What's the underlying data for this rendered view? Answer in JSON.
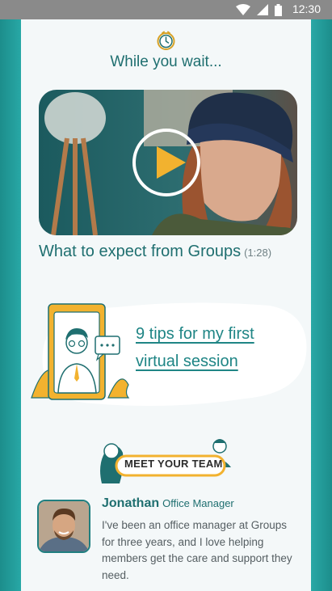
{
  "status_bar": {
    "time": "12:30",
    "icons": [
      "wifi-icon",
      "signal-icon",
      "battery-icon"
    ]
  },
  "header": {
    "icon": "clock-icon",
    "title": "While you wait..."
  },
  "video": {
    "title": "What to expect from Groups",
    "duration": "(1:28)",
    "play_icon": "play-icon"
  },
  "tips": {
    "link_line1": "9 tips for my first",
    "link_line2": "virtual session"
  },
  "team": {
    "badge_label": "MEET YOUR TEAM"
  },
  "member": {
    "name": "Jonathan",
    "role": "Office Manager",
    "bio": "I've been an office manager at Groups for three years, and I love helping members get the care and support they need."
  },
  "colors": {
    "teal_dark": "#1f6f70",
    "teal_bg": "#1f8c8a",
    "card_bg": "#f4f8f9",
    "accent_yellow": "#f2b22f"
  }
}
